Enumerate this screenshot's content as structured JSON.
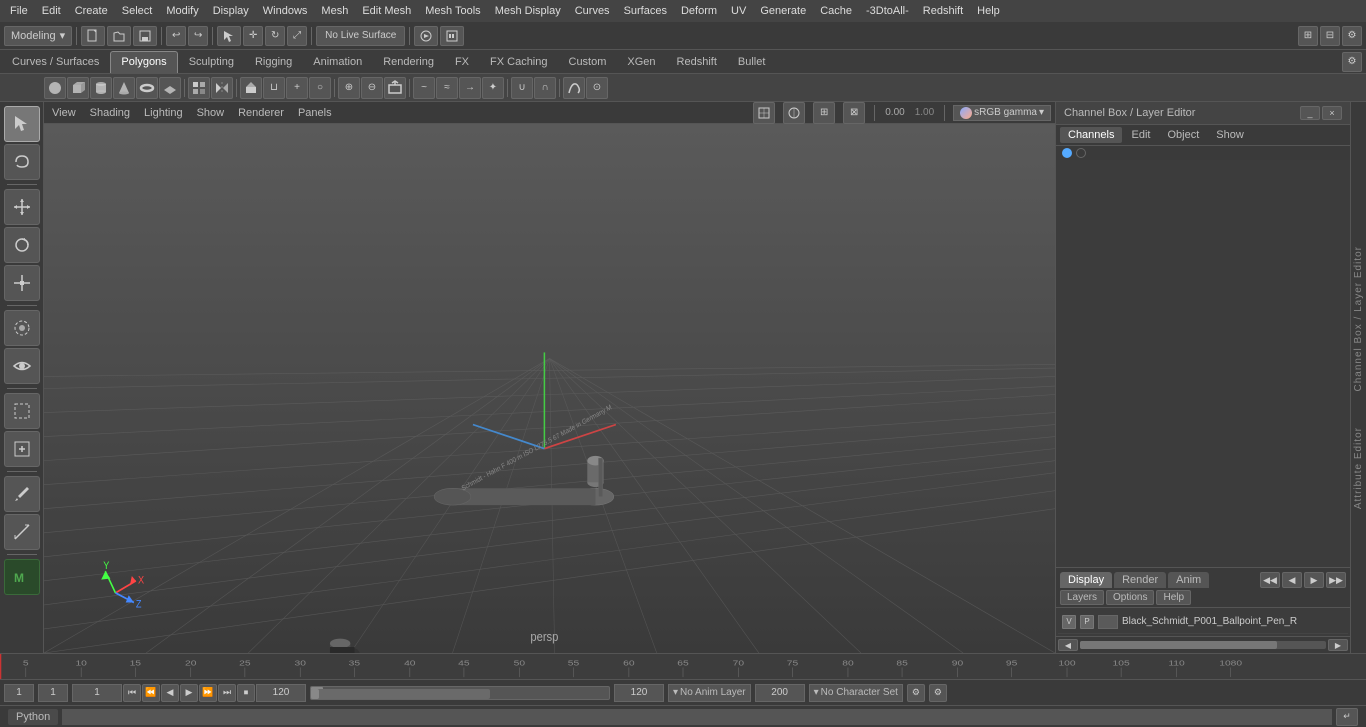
{
  "menubar": {
    "items": [
      "File",
      "Edit",
      "Create",
      "Select",
      "Modify",
      "Display",
      "Windows",
      "Mesh",
      "Edit Mesh",
      "Mesh Tools",
      "Mesh Display",
      "Curves",
      "Surfaces",
      "Deform",
      "UV",
      "Generate",
      "Cache",
      "-3DtoAll-",
      "Redshift",
      "Help"
    ]
  },
  "toolbar1": {
    "workspace_label": "Modeling",
    "live_surface": "No Live Surface",
    "icons": [
      "folder-open",
      "save",
      "undo",
      "redo",
      "transform",
      "rotate",
      "scale"
    ]
  },
  "tabs": {
    "items": [
      "Curves / Surfaces",
      "Polygons",
      "Sculpting",
      "Rigging",
      "Animation",
      "Rendering",
      "FX",
      "FX Caching",
      "Custom",
      "XGen",
      "Redshift",
      "Bullet"
    ],
    "active": "Polygons"
  },
  "viewport_menu": {
    "items": [
      "View",
      "Shading",
      "Lighting",
      "Show",
      "Renderer",
      "Panels"
    ]
  },
  "viewport": {
    "label": "persp",
    "camera_rotation": "0.00",
    "camera_scale": "1.00",
    "color_space": "sRGB gamma"
  },
  "right_panel": {
    "title": "Channel Box / Layer Editor",
    "tabs": [
      "Channels",
      "Edit",
      "Object",
      "Show"
    ],
    "layer_tabs": [
      "Display",
      "Render",
      "Anim"
    ],
    "layer_options": [
      "Layers",
      "Options",
      "Help"
    ],
    "layers": [
      {
        "visible": "V",
        "playback": "P",
        "name": "Black_Schmidt_P001_Ballpoint_Pen_R"
      }
    ],
    "active_layer_tab": "Display"
  },
  "timeline": {
    "start": "1",
    "end": "120",
    "current": "1",
    "range_start": "1",
    "range_end": "120",
    "max_end": "200",
    "ticks": [
      "",
      "5",
      "10",
      "15",
      "20",
      "25",
      "30",
      "35",
      "40",
      "45",
      "50",
      "55",
      "60",
      "65",
      "70",
      "75",
      "80",
      "85",
      "90",
      "95",
      "100",
      "105",
      "110",
      "1080"
    ]
  },
  "bottom_bar": {
    "frame_current": "1",
    "frame_input2": "1",
    "range_start": "1",
    "range_end": "120",
    "max_range": "200",
    "anim_layer": "No Anim Layer",
    "char_set": "No Character Set",
    "playback_buttons": [
      "<<",
      "<|",
      "<",
      "▶",
      ">",
      "|>",
      ">>",
      "||"
    ]
  },
  "python_bar": {
    "label": "Python",
    "placeholder": ""
  },
  "side_labels": {
    "channel_box": "Channel Box / Layer Editor",
    "attribute_editor": "Attribute Editor"
  },
  "colors": {
    "bg_dark": "#2a2a2a",
    "bg_mid": "#3a3a3a",
    "bg_light": "#4a4a4a",
    "accent": "#cc3333",
    "border": "#555555",
    "text": "#cccccc",
    "text_dim": "#888888"
  }
}
